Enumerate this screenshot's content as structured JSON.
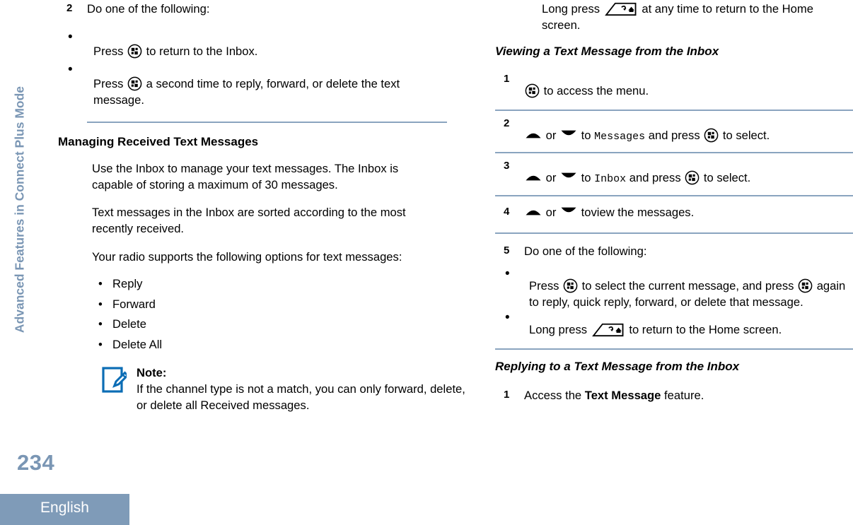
{
  "sidebar": {
    "chapter_label": "Advanced Features in Connect Plus Mode"
  },
  "footer": {
    "page_number": "234",
    "language": "English"
  },
  "colors": {
    "rule": "#8aa4bf",
    "accent_blue_gray": "#7a96b4",
    "language_band": "#7f9bb8",
    "note_icon_blue": "#0c6db5",
    "text": "#000000"
  },
  "icons": {
    "menu": "menu-button-icon",
    "home": "back-home-button-icon",
    "up": "up-arrow-icon",
    "down": "down-arrow-icon",
    "note": "note-pencil-icon"
  },
  "left_column": {
    "step2": {
      "number": "2",
      "text": "Do one of the following:",
      "bullets": [
        {
          "before": "Press",
          "icon": "menu",
          "after": "to return to the Inbox."
        },
        {
          "before": "Press",
          "icon": "menu",
          "after": "a second time to reply, forward, or delete the text message."
        }
      ]
    },
    "section_heading": "Managing Received Text Messages",
    "paragraphs": [
      "Use the Inbox to manage your text messages. The Inbox is capable of storing a maximum of 30 messages.",
      "Text messages in the Inbox are sorted according to the most recently received.",
      "Your radio supports the following options for text messages:"
    ],
    "options": [
      "Reply",
      "Forward",
      "Delete",
      "Delete All"
    ],
    "note": {
      "title": "Note:",
      "body": "If the channel type is not a match, you can only forward, delete, or delete all Received messages."
    }
  },
  "right_column": {
    "intro_bullet": {
      "before": "Long press",
      "icon": "home",
      "after": "at any time to return to the Home screen."
    },
    "heading_viewing": "Viewing a Text Message from the Inbox",
    "viewing_steps": [
      {
        "number": "1",
        "icon": "menu",
        "after": "to access the menu."
      },
      {
        "number": "2",
        "after_up_down": "to",
        "target": "Messages",
        "middle": "and press",
        "icon": "menu",
        "tail": "to select."
      },
      {
        "number": "3",
        "after_up_down": "to",
        "target": "Inbox",
        "middle": "and press",
        "icon": "menu",
        "tail": "to select."
      },
      {
        "number": "4",
        "after_up_down": "toview the messages."
      },
      {
        "number": "5",
        "text": "Do one of the following:",
        "bullets": [
          {
            "before": "Press",
            "icon": "menu",
            "mid": "to select the current message, and press",
            "icon2": "menu",
            "after": "again to reply, quick reply, forward, or delete that message."
          },
          {
            "before": "Long press",
            "icon": "home",
            "after": "to return to the Home screen."
          }
        ]
      }
    ],
    "heading_replying": "Replying to a Text Message from the Inbox",
    "replying_steps": [
      {
        "number": "1",
        "before": "Access the",
        "bold": "Text Message",
        "after": "feature."
      }
    ],
    "labels": {
      "or": "or"
    }
  }
}
